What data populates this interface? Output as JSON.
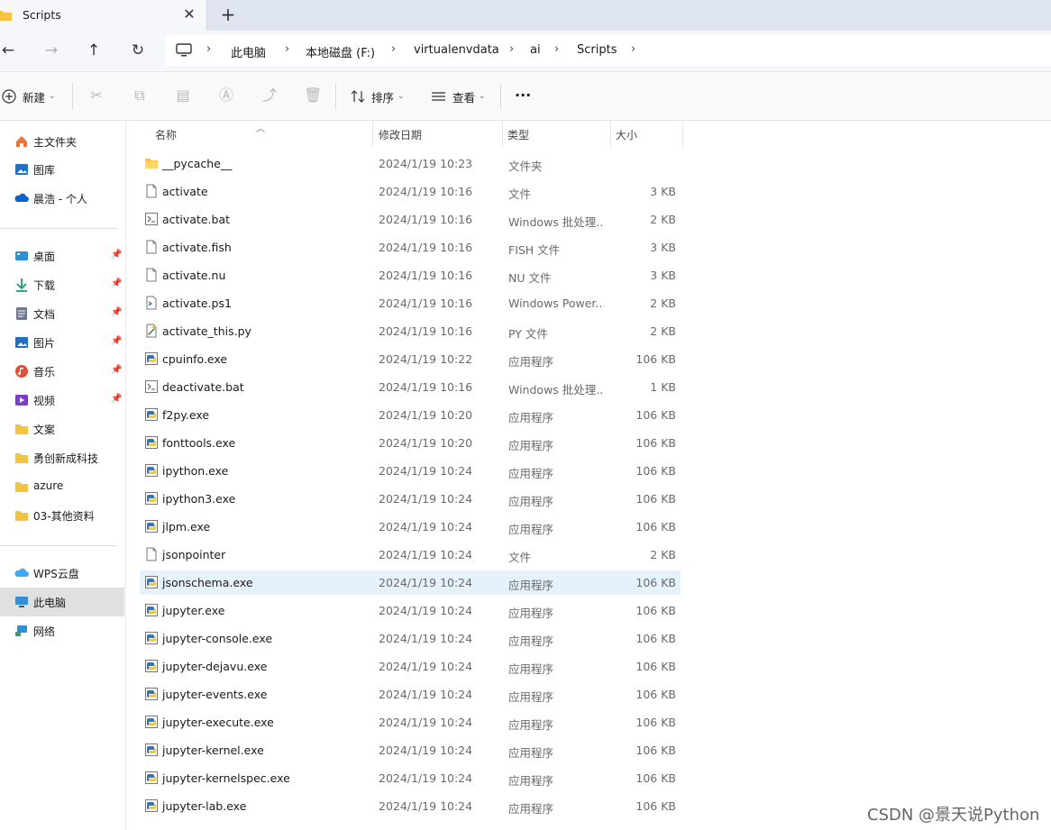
{
  "window": {
    "tab_title": "Scripts",
    "close_glyph": "✕",
    "new_tab_glyph": "+"
  },
  "nav": {
    "back": "←",
    "forward": "→",
    "up": "↑",
    "refresh": "↻",
    "breadcrumbs": [
      "此电脑",
      "本地磁盘 (F:)",
      "virtualenvdata",
      "ai",
      "Scripts"
    ],
    "sep": "›"
  },
  "toolbar": {
    "new_label": "新建",
    "sort_label": "排序",
    "view_label": "查看",
    "more_label": "···",
    "chevron": "⌄"
  },
  "sidebar": {
    "items": [
      {
        "label": "主文件夹",
        "icon": "home-icon"
      },
      {
        "label": "图库",
        "icon": "gallery-icon"
      },
      {
        "label": "晨浩 - 个人",
        "icon": "onedrive-icon"
      },
      {
        "label": "桌面",
        "icon": "desktop-icon",
        "pinned": true
      },
      {
        "label": "下载",
        "icon": "download-icon",
        "pinned": true
      },
      {
        "label": "文档",
        "icon": "documents-icon",
        "pinned": true
      },
      {
        "label": "图片",
        "icon": "pictures-icon",
        "pinned": true
      },
      {
        "label": "音乐",
        "icon": "music-icon",
        "pinned": true
      },
      {
        "label": "视频",
        "icon": "videos-icon",
        "pinned": true
      },
      {
        "label": "文案",
        "icon": "folder-icon"
      },
      {
        "label": "勇创新成科技",
        "icon": "folder-icon"
      },
      {
        "label": "azure",
        "icon": "folder-icon"
      },
      {
        "label": "03-其他资料",
        "icon": "folder-icon"
      },
      {
        "label": "WPS云盘",
        "icon": "cloud-icon"
      },
      {
        "label": "此电脑",
        "icon": "computer-icon",
        "selected": true
      },
      {
        "label": "网络",
        "icon": "network-icon"
      }
    ]
  },
  "list": {
    "columns": {
      "name": "名称",
      "date": "修改日期",
      "type": "类型",
      "size": "大小"
    },
    "rows": [
      {
        "name": "__pycache__",
        "date": "2024/1/19 10:23",
        "type": "文件夹",
        "size": "",
        "icon": "folder"
      },
      {
        "name": "activate",
        "date": "2024/1/19 10:16",
        "type": "文件",
        "size": "3 KB",
        "icon": "file"
      },
      {
        "name": "activate.bat",
        "date": "2024/1/19 10:16",
        "type": "Windows 批处理...",
        "size": "2 KB",
        "icon": "bat"
      },
      {
        "name": "activate.fish",
        "date": "2024/1/19 10:16",
        "type": "FISH 文件",
        "size": "3 KB",
        "icon": "file"
      },
      {
        "name": "activate.nu",
        "date": "2024/1/19 10:16",
        "type": "NU 文件",
        "size": "3 KB",
        "icon": "file"
      },
      {
        "name": "activate.ps1",
        "date": "2024/1/19 10:16",
        "type": "Windows Power...",
        "size": "2 KB",
        "icon": "ps1"
      },
      {
        "name": "activate_this.py",
        "date": "2024/1/19 10:16",
        "type": "PY 文件",
        "size": "2 KB",
        "icon": "py"
      },
      {
        "name": "cpuinfo.exe",
        "date": "2024/1/19 10:22",
        "type": "应用程序",
        "size": "106 KB",
        "icon": "exe"
      },
      {
        "name": "deactivate.bat",
        "date": "2024/1/19 10:16",
        "type": "Windows 批处理...",
        "size": "1 KB",
        "icon": "bat"
      },
      {
        "name": "f2py.exe",
        "date": "2024/1/19 10:20",
        "type": "应用程序",
        "size": "106 KB",
        "icon": "exe"
      },
      {
        "name": "fonttools.exe",
        "date": "2024/1/19 10:20",
        "type": "应用程序",
        "size": "106 KB",
        "icon": "exe"
      },
      {
        "name": "ipython.exe",
        "date": "2024/1/19 10:24",
        "type": "应用程序",
        "size": "106 KB",
        "icon": "exe"
      },
      {
        "name": "ipython3.exe",
        "date": "2024/1/19 10:24",
        "type": "应用程序",
        "size": "106 KB",
        "icon": "exe"
      },
      {
        "name": "jlpm.exe",
        "date": "2024/1/19 10:24",
        "type": "应用程序",
        "size": "106 KB",
        "icon": "exe"
      },
      {
        "name": "jsonpointer",
        "date": "2024/1/19 10:24",
        "type": "文件",
        "size": "2 KB",
        "icon": "file"
      },
      {
        "name": "jsonschema.exe",
        "date": "2024/1/19 10:24",
        "type": "应用程序",
        "size": "106 KB",
        "icon": "exe",
        "hover": true
      },
      {
        "name": "jupyter.exe",
        "date": "2024/1/19 10:24",
        "type": "应用程序",
        "size": "106 KB",
        "icon": "exe"
      },
      {
        "name": "jupyter-console.exe",
        "date": "2024/1/19 10:24",
        "type": "应用程序",
        "size": "106 KB",
        "icon": "exe"
      },
      {
        "name": "jupyter-dejavu.exe",
        "date": "2024/1/19 10:24",
        "type": "应用程序",
        "size": "106 KB",
        "icon": "exe"
      },
      {
        "name": "jupyter-events.exe",
        "date": "2024/1/19 10:24",
        "type": "应用程序",
        "size": "106 KB",
        "icon": "exe"
      },
      {
        "name": "jupyter-execute.exe",
        "date": "2024/1/19 10:24",
        "type": "应用程序",
        "size": "106 KB",
        "icon": "exe"
      },
      {
        "name": "jupyter-kernel.exe",
        "date": "2024/1/19 10:24",
        "type": "应用程序",
        "size": "106 KB",
        "icon": "exe"
      },
      {
        "name": "jupyter-kernelspec.exe",
        "date": "2024/1/19 10:24",
        "type": "应用程序",
        "size": "106 KB",
        "icon": "exe"
      },
      {
        "name": "jupyter-lab.exe",
        "date": "2024/1/19 10:24",
        "type": "应用程序",
        "size": "106 KB",
        "icon": "exe"
      }
    ]
  },
  "watermark": "CSDN @景天说Python",
  "colors": {
    "hover_row": "#e5f1fb",
    "selected_nav": "#e0e0e0",
    "folder": "#f5c242"
  }
}
